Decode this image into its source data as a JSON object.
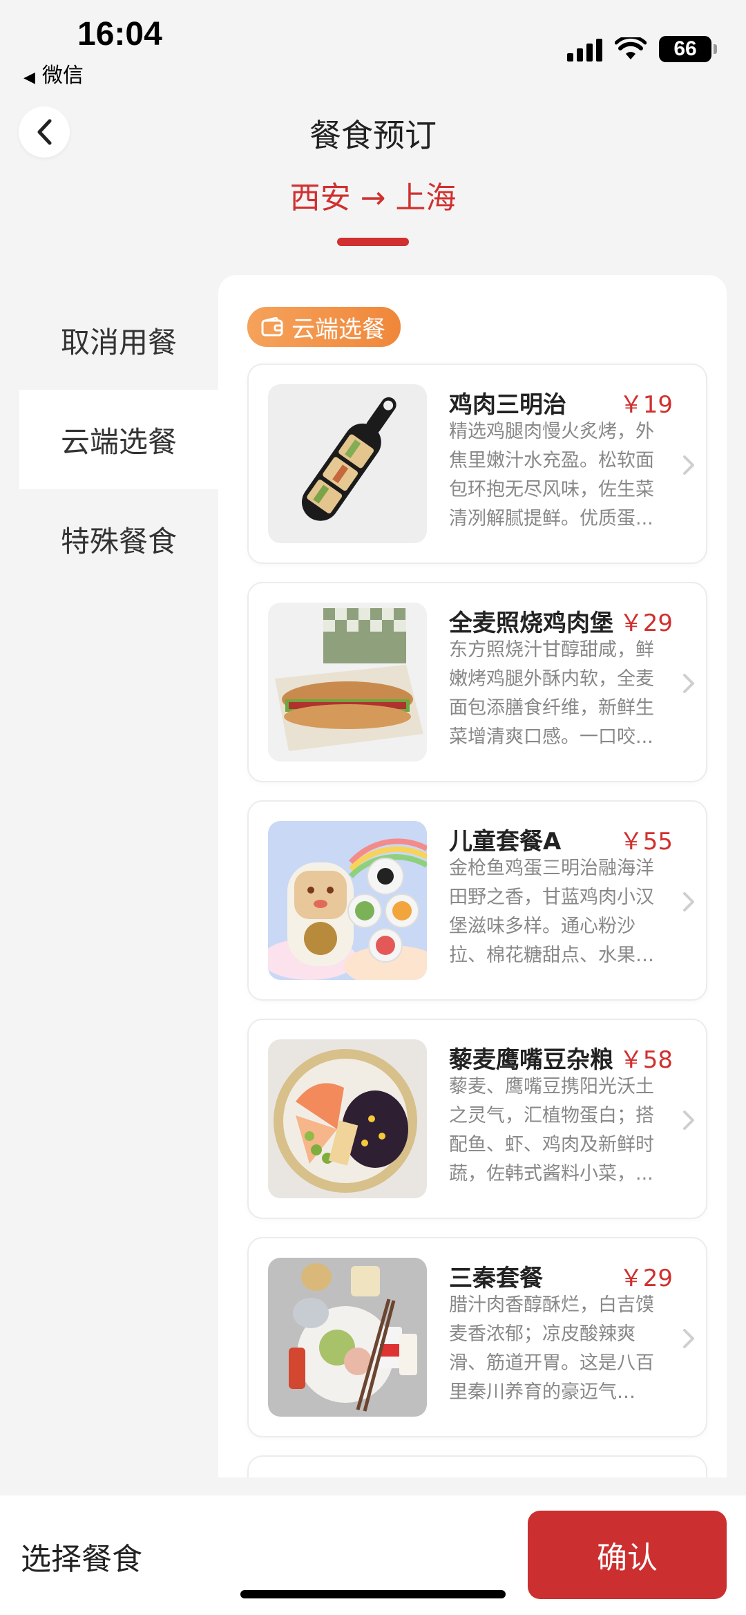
{
  "status_bar": {
    "time": "16:04",
    "back_app": "微信",
    "battery": "66"
  },
  "header": {
    "title": "餐食预订",
    "route": "西安 → 上海"
  },
  "side_nav": {
    "items": [
      {
        "label": "取消用餐"
      },
      {
        "label": "云端选餐"
      },
      {
        "label": "特殊餐食"
      }
    ],
    "active_index": 1
  },
  "section": {
    "tag_label": "云端选餐"
  },
  "meals": [
    {
      "name": "鸡肉三明治",
      "price": "￥19",
      "desc": "精选鸡腿肉慢火炙烤，外焦里嫩汁水充盈。松软面包环抱无尽风味，佐生菜清冽解腻提鲜。优质蛋..."
    },
    {
      "name": "全麦照烧鸡肉堡",
      "price": "￥29",
      "desc": "东方照烧汁甘醇甜咸，鲜嫩烤鸡腿外酥内软，全麦面包添膳食纤维，新鲜生菜增清爽口感。一口咬..."
    },
    {
      "name": "儿童套餐A",
      "price": "￥55",
      "desc": "金枪鱼鸡蛋三明治融海洋田野之香，甘蓝鸡肉小汉堡滋味多样。通心粉沙拉、棉花糖甜点、水果切..."
    },
    {
      "name": "藜麦鹰嘴豆杂粮",
      "price": "￥58",
      "desc": "藜麦、鹰嘴豆携阳光沃土之灵气，汇植物蛋白；搭配鱼、虾、鸡肉及新鲜时蔬，佐韩式酱料小菜，..."
    },
    {
      "name": "三秦套餐",
      "price": "￥29",
      "desc": "腊汁肉香醇酥烂，白吉馍麦香浓郁；凉皮酸辣爽滑、筋道开胃。这是八百里秦川养育的豪迈气魄，..."
    }
  ],
  "bottom_bar": {
    "label": "选择餐食",
    "confirm_label": "确认"
  },
  "colors": {
    "accent": "#d0302f",
    "tag_orange": "#f0873a"
  }
}
